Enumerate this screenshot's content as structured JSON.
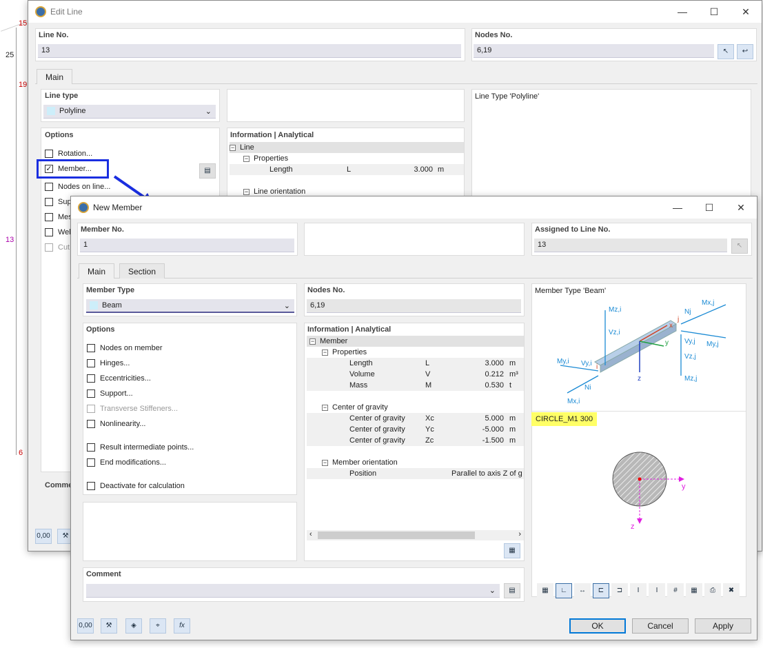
{
  "background": {
    "node_labels": [
      "15",
      "25",
      "19",
      "13",
      "6"
    ]
  },
  "edit_line": {
    "title": "Edit Line",
    "line_no_label": "Line No.",
    "line_no": "13",
    "nodes_no_label": "Nodes No.",
    "nodes_no": "6,19",
    "tabs": [
      "Main"
    ],
    "line_type_label": "Line type",
    "line_type": "Polyline",
    "options_label": "Options",
    "options": [
      {
        "label": "Rotation...",
        "checked": false
      },
      {
        "label": "Member...",
        "checked": true
      },
      {
        "label": "Nodes on line...",
        "checked": false
      },
      {
        "label": "Sup",
        "checked": false
      },
      {
        "label": "Mes",
        "checked": false
      },
      {
        "label": "Wel",
        "checked": false
      },
      {
        "label": "Cut",
        "checked": false,
        "disabled": true
      }
    ],
    "info_label": "Information | Analytical",
    "info": {
      "line": "Line",
      "properties": "Properties",
      "length_label": "Length",
      "length_sym": "L",
      "length_val": "3.000",
      "length_unit": "m",
      "orientation": "Line orientation"
    },
    "preview_title": "Line Type 'Polyline'",
    "comment_label": "Comme",
    "footer_value": "0,00"
  },
  "new_member": {
    "title": "New Member",
    "member_no_label": "Member No.",
    "member_no": "1",
    "assigned_label": "Assigned to Line No.",
    "assigned": "13",
    "tabs": [
      "Main",
      "Section"
    ],
    "member_type_label": "Member Type",
    "member_type": "Beam",
    "nodes_no_label": "Nodes No.",
    "nodes_no": "6,19",
    "options_label": "Options",
    "options": [
      {
        "label": "Nodes on member",
        "checked": false
      },
      {
        "label": "Hinges...",
        "checked": false
      },
      {
        "label": "Eccentricities...",
        "checked": false
      },
      {
        "label": "Support...",
        "checked": false
      },
      {
        "label": "Transverse Stiffeners...",
        "checked": false,
        "disabled": true
      },
      {
        "label": "Nonlinearity...",
        "checked": false
      },
      {
        "label": "Result intermediate points...",
        "checked": false
      },
      {
        "label": "End modifications...",
        "checked": false
      },
      {
        "label": "Deactivate for calculation",
        "checked": false
      }
    ],
    "info_label": "Information | Analytical",
    "info": {
      "member": "Member",
      "properties": "Properties",
      "props": [
        {
          "name": "Length",
          "sym": "L",
          "val": "3.000",
          "unit": "m"
        },
        {
          "name": "Volume",
          "sym": "V",
          "val": "0.212",
          "unit": "m³"
        },
        {
          "name": "Mass",
          "sym": "M",
          "val": "0.530",
          "unit": "t"
        }
      ],
      "cog": "Center of gravity",
      "cogs": [
        {
          "name": "Center of gravity",
          "sym": "Xc",
          "val": "5.000",
          "unit": "m"
        },
        {
          "name": "Center of gravity",
          "sym": "Yc",
          "val": "-5.000",
          "unit": "m"
        },
        {
          "name": "Center of gravity",
          "sym": "Zc",
          "val": "-1.500",
          "unit": "m"
        }
      ],
      "orientation": "Member orientation",
      "position_label": "Position",
      "position_val": "Parallel to axis Z of g"
    },
    "preview_title": "Member Type 'Beam'",
    "diagram_labels": {
      "mzi": "Mz,i",
      "vzi": "Vz,i",
      "myi": "My,i",
      "vyi": "Vy,i",
      "ni": "Ni",
      "mxi": "Mx,i",
      "nj": "Nj",
      "mxj": "Mx,j",
      "vyj": "Vy,j",
      "myj": "My,j",
      "vzj": "Vz,j",
      "mzj": "Mz,j",
      "i": "i",
      "j": "j",
      "x": "x",
      "y": "y",
      "z": "z"
    },
    "section_name": "CIRCLE_M1 300",
    "section_axes": {
      "y": "y",
      "z": "z"
    },
    "comment_label": "Comment",
    "footer_value": "0,00",
    "buttons": {
      "ok": "OK",
      "cancel": "Cancel",
      "apply": "Apply"
    },
    "colors": {
      "accent": "#0078d7",
      "highlight": "#ffff66",
      "axis": "#e020e0"
    }
  }
}
